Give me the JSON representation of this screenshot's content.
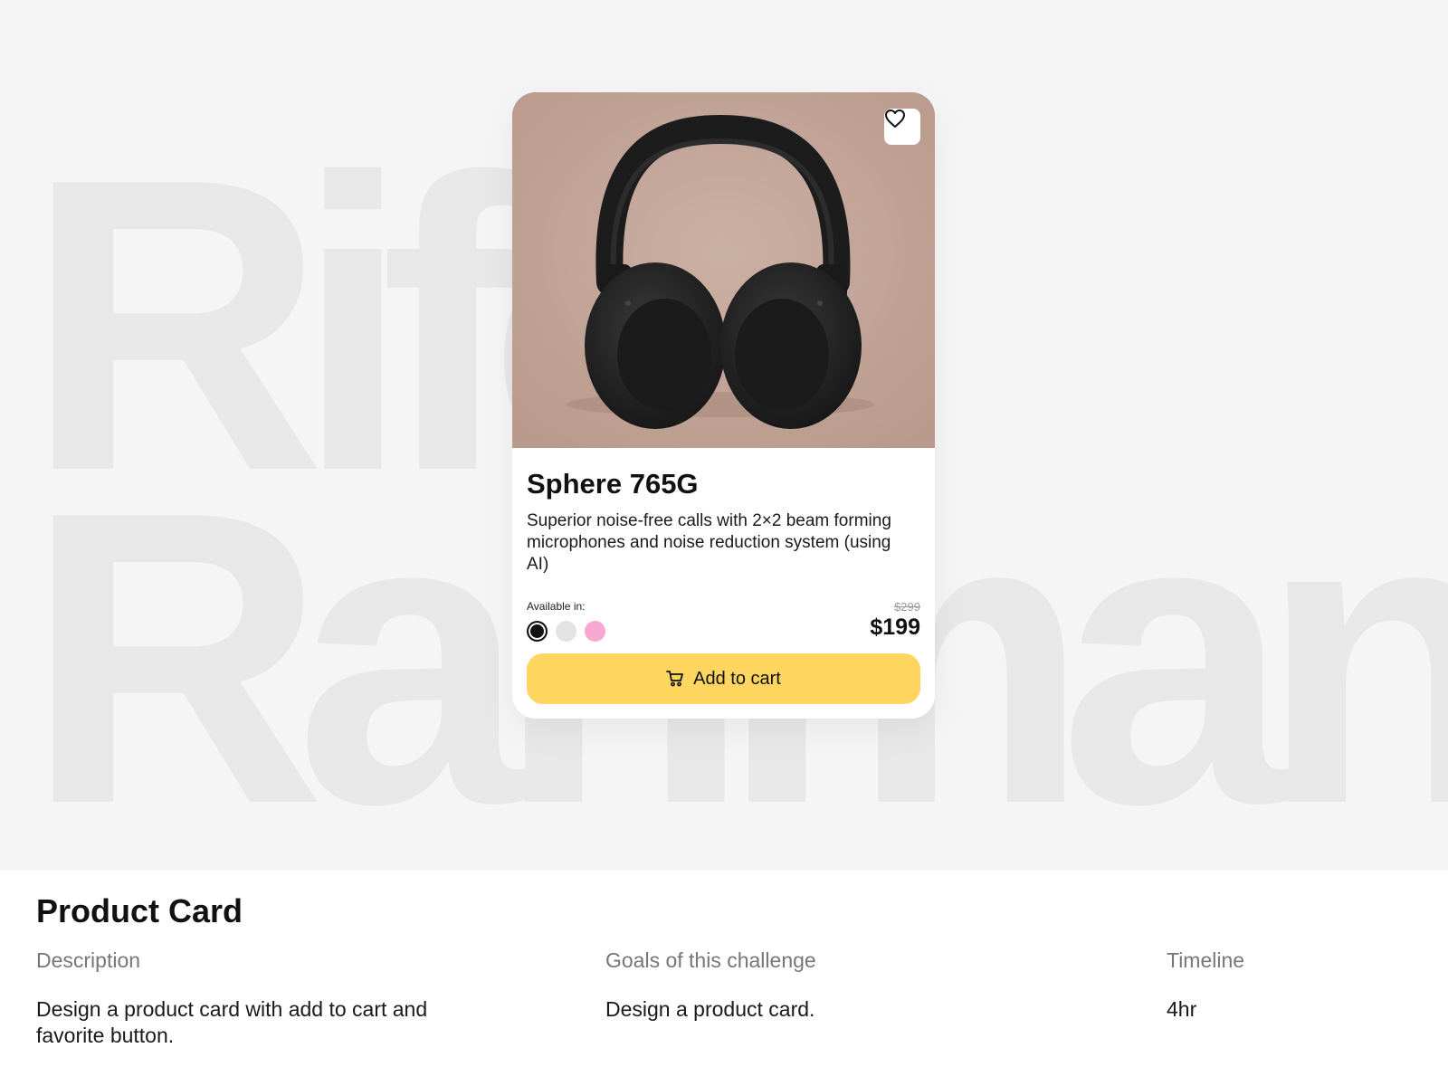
{
  "background": {
    "line1": "Rifo",
    "line2": "Rahman"
  },
  "card": {
    "image_alt": "Black over-ear headphones",
    "favorite_icon": "heart-icon",
    "title": "Sphere 765G",
    "description": "Superior noise-free calls with 2×2 beam forming microphones and noise reduction system (using AI)",
    "available_label": "Available in:",
    "colors": [
      {
        "name": "black",
        "hex": "#111111",
        "selected": true
      },
      {
        "name": "grey",
        "hex": "#e3e3e3",
        "selected": false
      },
      {
        "name": "pink",
        "hex": "#f8a8d1",
        "selected": false
      }
    ],
    "old_price": "$299",
    "price": "$199",
    "cart_icon": "cart-icon",
    "cart_label": "Add to cart",
    "accent_color": "#fdd55f"
  },
  "info": {
    "title": "Product Card",
    "description_heading": "Description",
    "description_text": "Design a product card with add to cart and favorite button.",
    "goals_heading": "Goals of this challenge",
    "goals_text": "Design a product card.",
    "timeline_heading": "Timeline",
    "timeline_text": "4hr"
  }
}
